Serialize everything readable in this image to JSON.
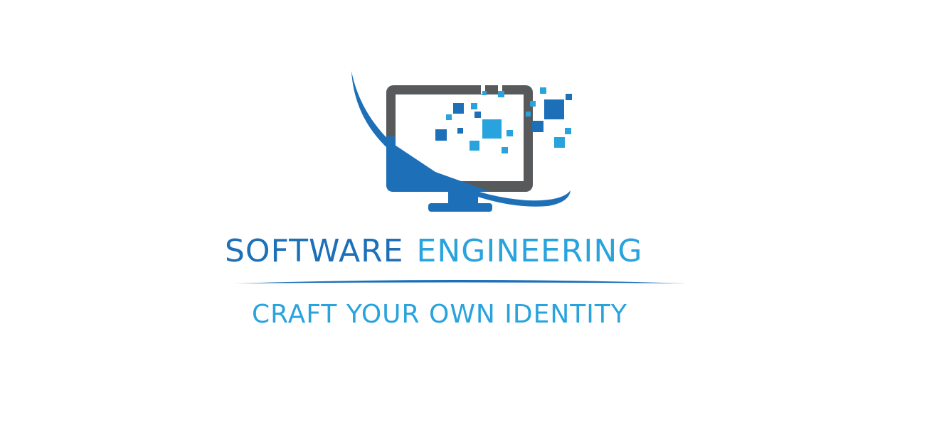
{
  "logo": {
    "title_word_1": "SOFTWARE",
    "title_word_2": "ENGINEERING",
    "tagline": "CRAFT YOUR OWN IDENTITY",
    "icon": "computer-monitor-icon"
  },
  "colors": {
    "background": "#ffffff",
    "dark_blue": "#1d70b8",
    "light_blue": "#29a3dd",
    "monitor_gray": "#58595b"
  }
}
